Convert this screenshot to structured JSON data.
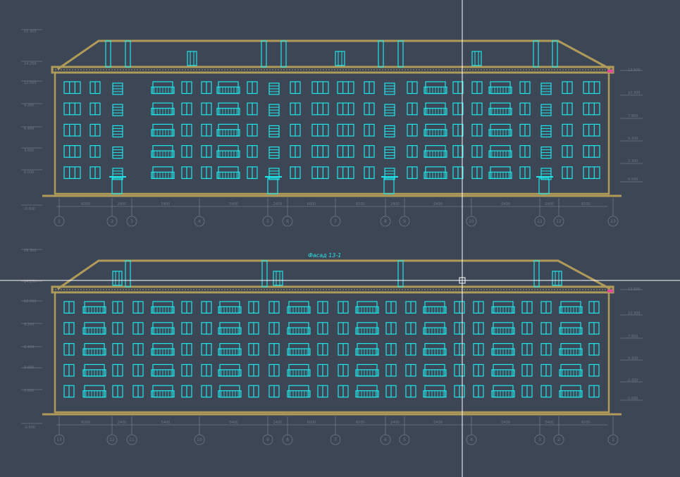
{
  "colors": {
    "background": "#3d4655",
    "building": "#b09a5a",
    "windows": "#1fe6ea",
    "dimensions": "#6f7787",
    "crosshair": "#ffffff",
    "accent": "#e14b9d"
  },
  "facade_title": "Фасад 13-1",
  "elevations_left": [
    "15.300",
    "14.250",
    "12.000",
    "9.200",
    "6.400",
    "3.600",
    "0.000",
    "-0.600"
  ],
  "elevations_right": [
    "13.500",
    "10.300",
    "7.900",
    "5.100",
    "2.300",
    "0.000"
  ],
  "elevations_right_bottom": [
    "13.500",
    "10.300",
    "7.900",
    "5.100",
    "2.300",
    "0.000"
  ],
  "top_elevation": {
    "axes": [
      "1",
      "2",
      "3",
      "4",
      "5",
      "6",
      "7",
      "8",
      "9",
      "10",
      "11",
      "12",
      "13"
    ],
    "dimensions": [
      "6000",
      "2400",
      "5400",
      "5400",
      "2400",
      "6000",
      "6000",
      "2400",
      "5400",
      "5400",
      "2400",
      "6000"
    ]
  },
  "bottom_elevation": {
    "axes": [
      "13",
      "12",
      "11",
      "10",
      "9",
      "8",
      "7",
      "6",
      "5",
      "4",
      "3",
      "2",
      "1"
    ],
    "dimensions": [
      "6000",
      "2400",
      "5400",
      "5400",
      "2400",
      "6000",
      "6000",
      "2400",
      "5400",
      "5400",
      "2400",
      "6000"
    ]
  }
}
